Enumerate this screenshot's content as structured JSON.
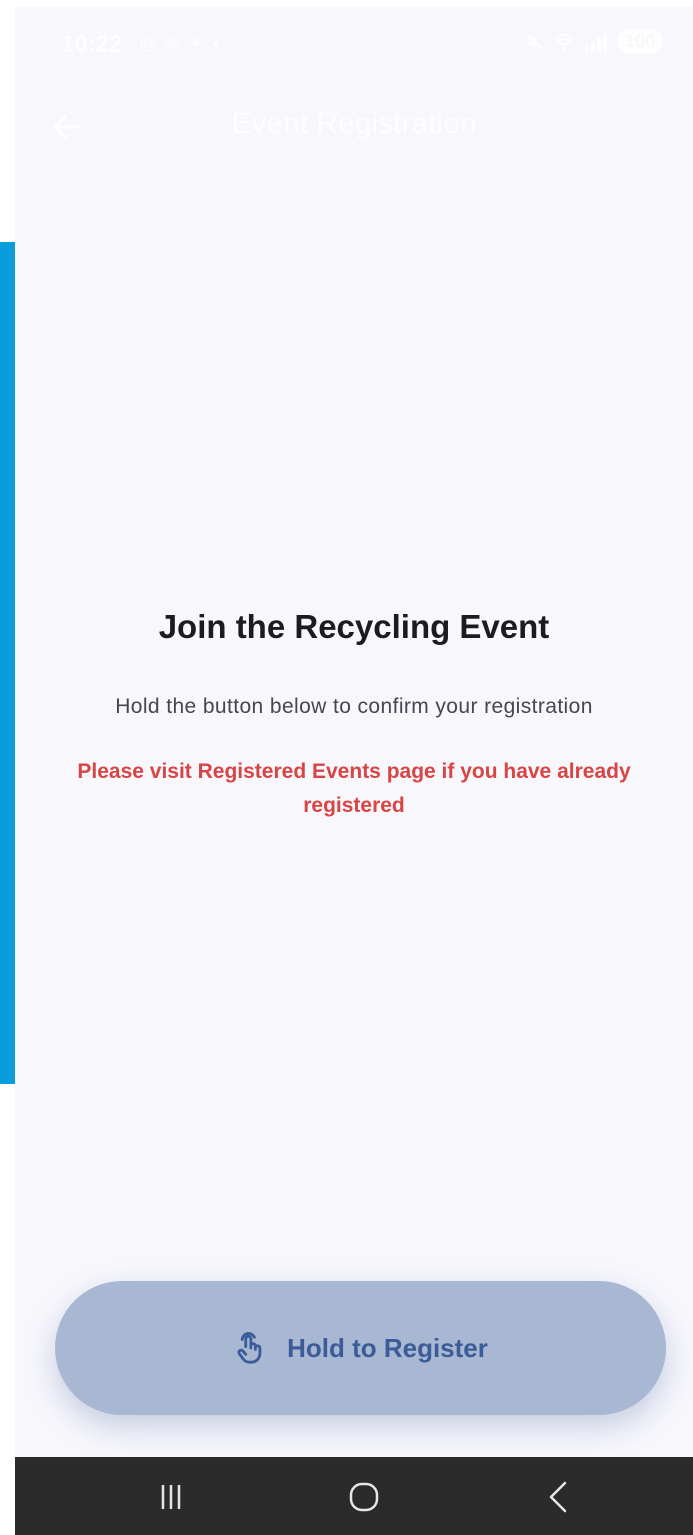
{
  "status_bar": {
    "time": "10:22",
    "left_icons": [
      "@",
      "✉",
      "⚘",
      "•"
    ],
    "right_icons": [
      "🔇",
      "⚑",
      "signal"
    ],
    "battery": "100"
  },
  "app_bar": {
    "title": "Event Registration",
    "back_icon": "arrow-left-icon"
  },
  "content": {
    "heading": "Join the Recycling Event",
    "subtitle": "Hold the button below to confirm your registration",
    "warning": "Please visit Registered Events page if you have already registered"
  },
  "hold_button": {
    "label": "Hold to Register",
    "icon": "touch-hand-icon",
    "progress": 0
  },
  "nav_bar": {
    "recent_icon": "recent-apps-icon",
    "home_icon": "home-icon",
    "back_icon": "back-icon"
  },
  "colors": {
    "background": "#f7f7fc",
    "accent_side": "#0a9ddb",
    "warning": "#d94444",
    "button_bg": "#a8b8d3",
    "button_text": "#3b5c98",
    "nav_bar": "#2b2b2b"
  }
}
